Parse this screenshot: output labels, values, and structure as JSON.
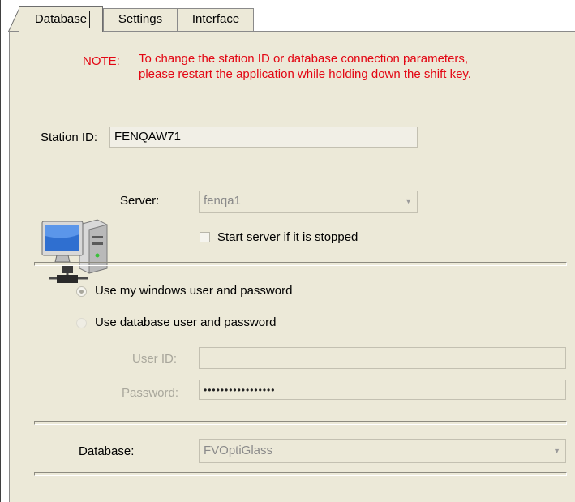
{
  "tabs": [
    {
      "label": "Database",
      "active": true
    },
    {
      "label": "Settings",
      "active": false
    },
    {
      "label": "Interface",
      "active": false
    }
  ],
  "note": {
    "label": "NOTE:",
    "line1": "To change the station ID or database connection parameters,",
    "line2": "please restart the application while holding down the shift key."
  },
  "station": {
    "label": "Station ID:",
    "value": "FENQAW71"
  },
  "server": {
    "icon": "computer-server-icon",
    "label": "Server:",
    "value": "fenqa1",
    "start_server_label": "Start server if it is stopped"
  },
  "auth": {
    "windows_label": "Use my windows user and password",
    "database_label": "Use database user and password",
    "windows_selected": true
  },
  "credentials": {
    "user_id_label": "User ID:",
    "user_id_value": "",
    "password_label": "Password:",
    "password_value": "•••••••••••••••••"
  },
  "database": {
    "label": "Database:",
    "value": "FVOptiGlass"
  },
  "colors": {
    "note": "#e30613",
    "panel_bg": "#ece9d8",
    "disabled_text": "#a9a79c"
  }
}
